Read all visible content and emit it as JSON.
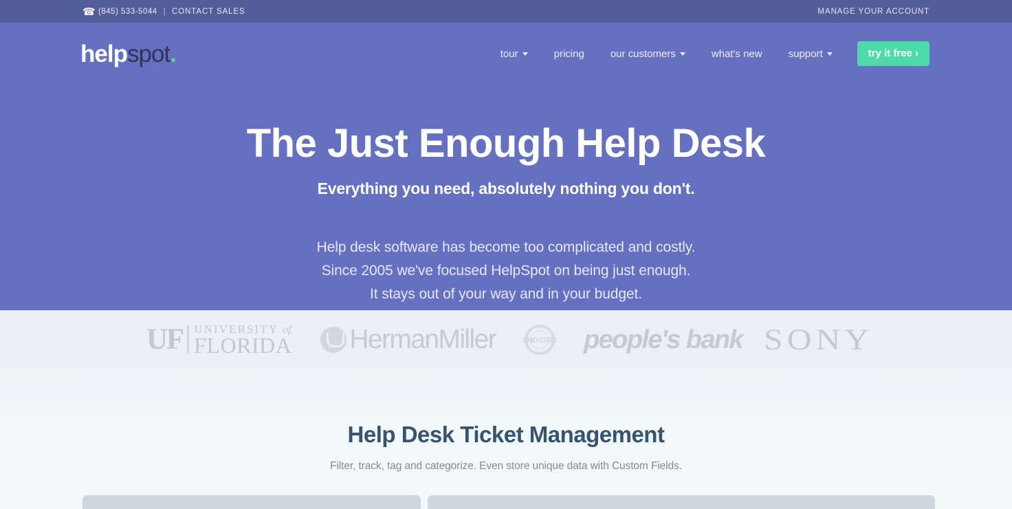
{
  "utility_bar": {
    "phone_icon": "telephone-icon",
    "phone": "(845) 533-5044",
    "separator": "|",
    "contact_link": "CONTACT SALES",
    "account_link": "MANAGE YOUR ACCOUNT",
    "background": "#525e99"
  },
  "header": {
    "logo": {
      "part1": "help",
      "part2": "spot",
      "dot": "."
    },
    "nav": [
      {
        "label": "tour",
        "has_caret": true
      },
      {
        "label": "pricing",
        "has_caret": false
      },
      {
        "label": "our customers",
        "has_caret": true
      },
      {
        "label": "what's new",
        "has_caret": false
      },
      {
        "label": "support",
        "has_caret": true
      }
    ],
    "cta": {
      "label": "try it free ›",
      "color": "#4ddbab"
    },
    "background": "#6670c1"
  },
  "hero": {
    "title": "The Just Enough Help Desk",
    "subtitle": "Everything you need, absolutely nothing you don't.",
    "paragraph": [
      "Help desk software has become too complicated and costly.",
      "Since 2005 we've focused HelpSpot on being just enough.",
      "It stays out of your way and in your budget."
    ]
  },
  "clients": {
    "background": "#eaf0f3",
    "logos": [
      {
        "name": "university-of-florida",
        "mark": "UF",
        "line1": "UNIVERSITY",
        "line1_italic": "of",
        "line2": "FLORIDA"
      },
      {
        "name": "herman-miller",
        "text": "HermanMiller"
      },
      {
        "name": "ohio-state",
        "text": "OHIO STATE"
      },
      {
        "name": "peoples-bank",
        "text": "people's bank"
      },
      {
        "name": "sony",
        "text": "SONY"
      }
    ]
  },
  "feature": {
    "title": "Help Desk Ticket Management",
    "subtitle": "Filter, track, tag and categorize. Even store unique data with Custom Fields.",
    "title_color": "#37536f"
  }
}
